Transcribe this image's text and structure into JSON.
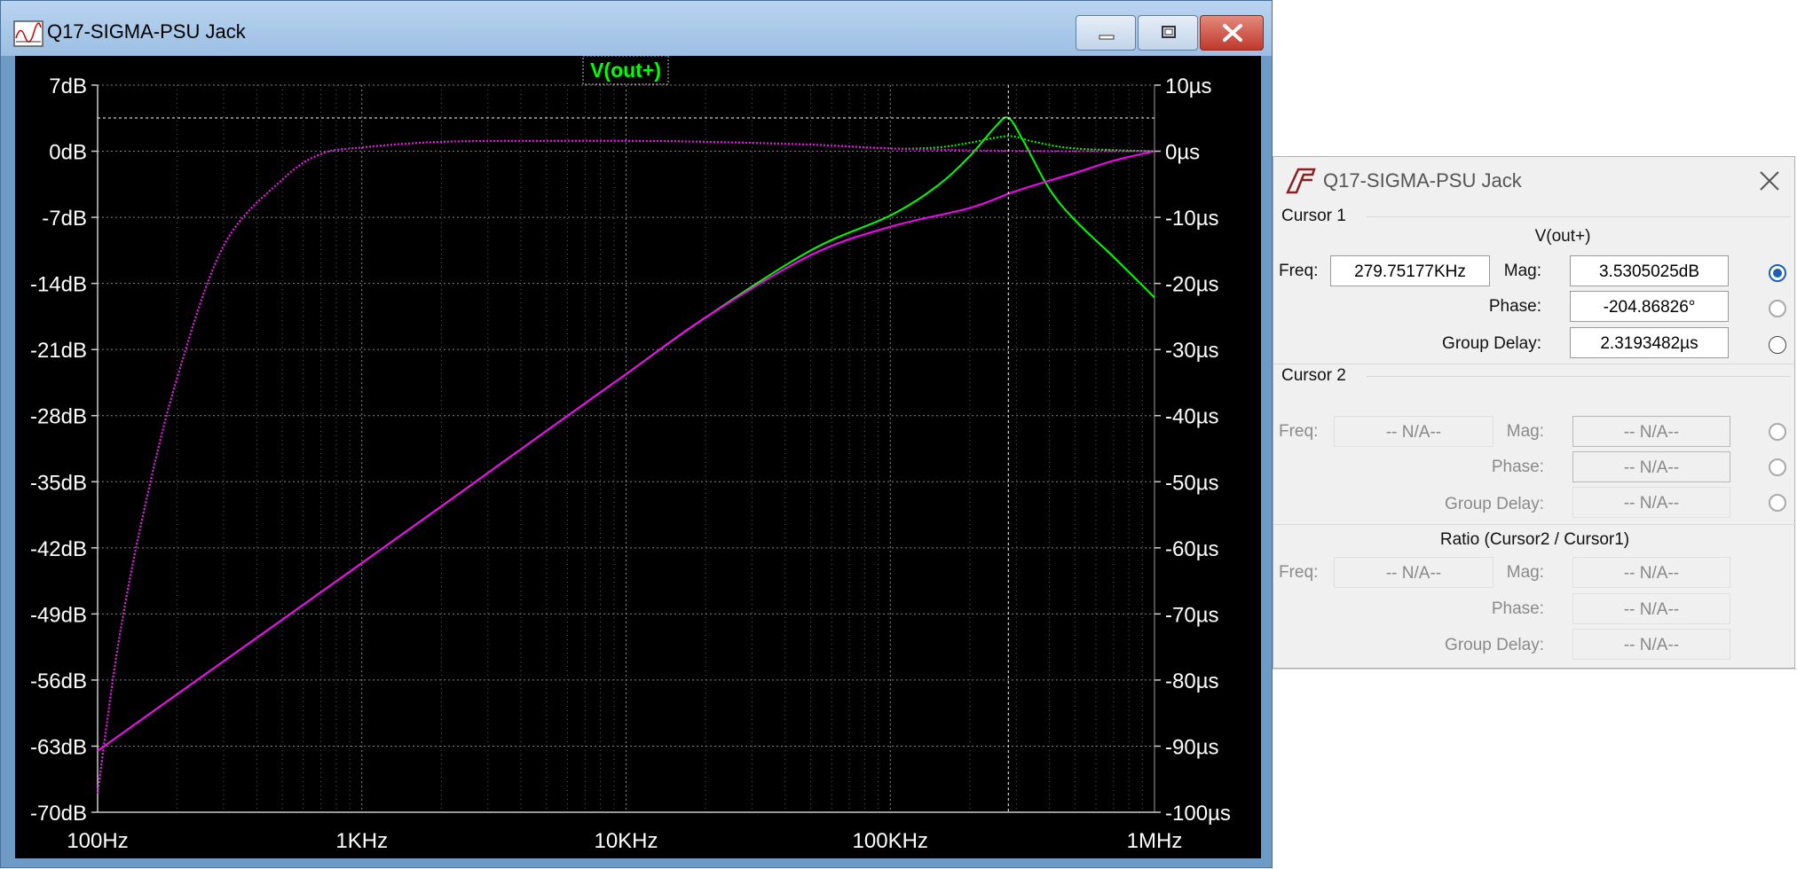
{
  "main_window": {
    "title": "Q17-SIGMA-PSU Jack",
    "trace_label": "V(out+)"
  },
  "colors": {
    "plot_bg": "#000000",
    "grid": "#9a9a9a",
    "trace_magnitude": "#00ff00",
    "trace_phase": "#ff00ff",
    "axis_text": "#ffffff"
  },
  "chart_data": {
    "type": "line",
    "title": "V(out+)",
    "x_scale": "log",
    "xlim": [
      100,
      1000000
    ],
    "x_ticks": [
      "100Hz",
      "1KHz",
      "10KHz",
      "100KHz",
      "1MHz"
    ],
    "y_left_ticks": [
      "7dB",
      "0dB",
      "-7dB",
      "-14dB",
      "-21dB",
      "-28dB",
      "-35dB",
      "-42dB",
      "-49dB",
      "-56dB",
      "-63dB",
      "-70dB"
    ],
    "y_right_ticks": [
      "10µs",
      "0µs",
      "-10µs",
      "-20µs",
      "-30µs",
      "-40µs",
      "-50µs",
      "-60µs",
      "-70µs",
      "-80µs",
      "-90µs",
      "-100µs"
    ],
    "ylim_left_db": [
      -70,
      7
    ],
    "ylim_right_us": [
      -100,
      10
    ],
    "series": [
      {
        "name": "V(out+)",
        "style": "solid",
        "color": "#00ff00",
        "points": [
          [
            100,
            -63.5
          ],
          [
            200,
            -57.5
          ],
          [
            500,
            -49.6
          ],
          [
            1000,
            -43.6
          ],
          [
            2000,
            -37.6
          ],
          [
            5000,
            -29.6
          ],
          [
            10000,
            -23.6
          ],
          [
            20000,
            -17.6
          ],
          [
            50000,
            -10.5
          ],
          [
            100000,
            -6.8
          ],
          [
            150000,
            -3.7
          ],
          [
            200000,
            -0.5
          ],
          [
            250000,
            2.6
          ],
          [
            279752,
            3.53
          ],
          [
            320000,
            1.0
          ],
          [
            400000,
            -4.0
          ],
          [
            500000,
            -7.3
          ],
          [
            700000,
            -11.2
          ],
          [
            1000000,
            -15.5
          ]
        ]
      },
      {
        "name": "",
        "style": "solid",
        "color": "#ff00ff",
        "points": [
          [
            100,
            -63.5
          ],
          [
            200,
            -57.5
          ],
          [
            500,
            -49.6
          ],
          [
            1000,
            -43.6
          ],
          [
            2000,
            -37.6
          ],
          [
            5000,
            -29.6
          ],
          [
            10000,
            -23.6
          ],
          [
            20000,
            -17.6
          ],
          [
            50000,
            -11.0
          ],
          [
            100000,
            -8.0
          ],
          [
            200000,
            -6.0
          ],
          [
            300000,
            -4.2
          ],
          [
            500000,
            -2.3
          ],
          [
            700000,
            -1.0
          ],
          [
            1000000,
            0.0
          ]
        ]
      },
      {
        "name": "",
        "style": "dotted",
        "color": "#00ff00",
        "points": [
          [
            100,
            -68
          ],
          [
            120,
            -52
          ],
          [
            150,
            -38
          ],
          [
            200,
            -24
          ],
          [
            300,
            -10
          ],
          [
            500,
            -3.0
          ],
          [
            700,
            -0.3
          ],
          [
            1000,
            0.4
          ],
          [
            2000,
            1.0
          ],
          [
            5000,
            1.1
          ],
          [
            10000,
            1.1
          ],
          [
            20000,
            1.0
          ],
          [
            50000,
            0.7
          ],
          [
            100000,
            0.3
          ],
          [
            150000,
            0.4
          ],
          [
            200000,
            0.9
          ],
          [
            279752,
            1.6
          ],
          [
            350000,
            1.0
          ],
          [
            500000,
            0.3
          ],
          [
            1000000,
            0.0
          ]
        ]
      },
      {
        "name": "",
        "style": "dotted",
        "color": "#ff00ff",
        "points": [
          [
            100,
            -68
          ],
          [
            120,
            -52
          ],
          [
            150,
            -38
          ],
          [
            200,
            -24
          ],
          [
            300,
            -10
          ],
          [
            500,
            -3.0
          ],
          [
            700,
            -0.3
          ],
          [
            1000,
            0.4
          ],
          [
            2000,
            1.0
          ],
          [
            5000,
            1.1
          ],
          [
            10000,
            1.1
          ],
          [
            20000,
            1.0
          ],
          [
            50000,
            0.7
          ],
          [
            100000,
            0.3
          ],
          [
            200000,
            0.1
          ],
          [
            500000,
            0.0
          ],
          [
            1000000,
            0.0
          ]
        ]
      }
    ],
    "cursor1": {
      "freq_hz": 279752,
      "mag_db": 3.53
    }
  },
  "cursor_dialog": {
    "title": "Q17-SIGMA-PSU Jack",
    "cursor1_heading": "Cursor 1",
    "trace_name": "V(out+)",
    "labels": {
      "freq": "Freq:",
      "mag": "Mag:",
      "phase": "Phase:",
      "group_delay": "Group Delay:"
    },
    "cursor1": {
      "freq": "279.75177KHz",
      "mag": "3.5305025dB",
      "phase": "-204.86826°",
      "group_delay": "2.3193482µs"
    },
    "cursor2_heading": "Cursor 2",
    "cursor2": {
      "freq": "-- N/A--",
      "mag": "-- N/A--",
      "phase": "-- N/A--",
      "group_delay": "-- N/A--"
    },
    "ratio_heading": "Ratio (Cursor2 / Cursor1)",
    "ratio": {
      "freq": "-- N/A--",
      "mag": "-- N/A--",
      "phase": "-- N/A--",
      "group_delay": "-- N/A--"
    }
  }
}
